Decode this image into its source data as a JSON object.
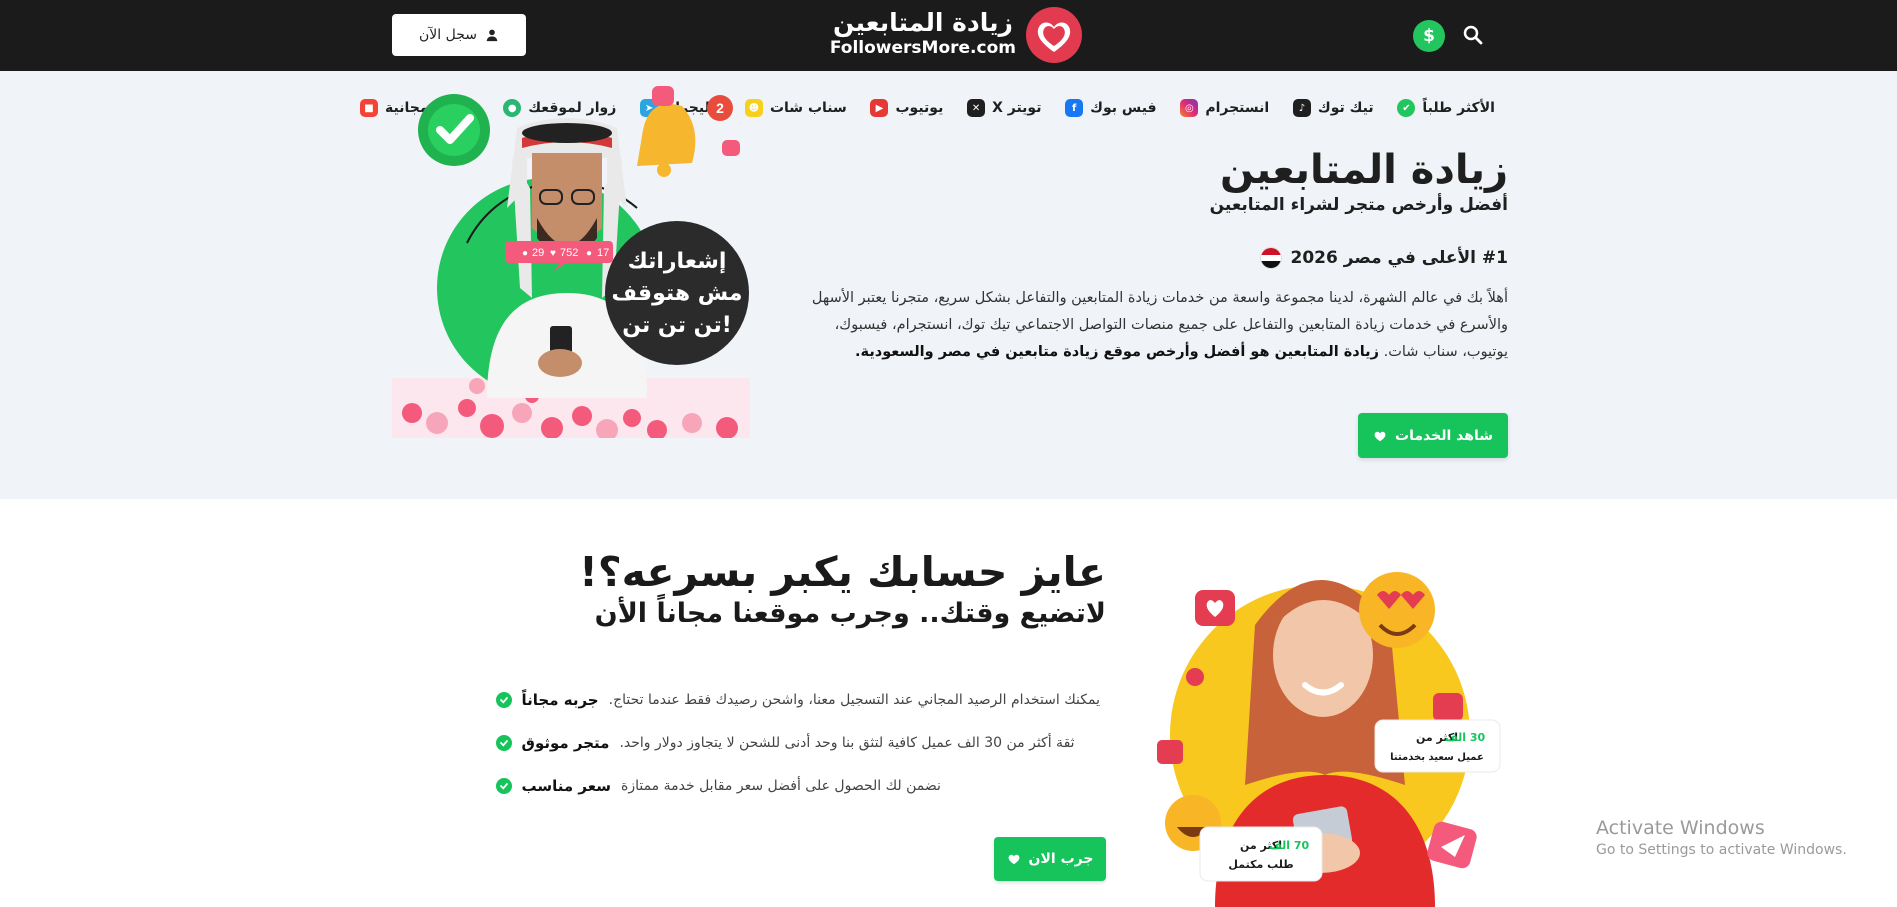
{
  "header": {
    "register_label": "سجل الآن",
    "logo_ar": "زيادة المتابعين",
    "logo_en": "FollowersMore.com",
    "dollar_symbol": "$",
    "icons": [
      "user-icon",
      "heart-logo-icon",
      "dollar-icon",
      "search-icon"
    ]
  },
  "nav": {
    "items": [
      {
        "label": "الأكثر طلباً",
        "icon": "check-badge-icon",
        "color": "#22c55e"
      },
      {
        "label": "تيك توك",
        "icon": "tiktok-icon",
        "color": "#1f1f1f"
      },
      {
        "label": "انستجرام",
        "icon": "instagram-icon",
        "color": "#d62976"
      },
      {
        "label": "فيس بوك",
        "icon": "facebook-icon",
        "color": "#1877f2"
      },
      {
        "label": "تويتر X",
        "icon": "x-icon",
        "color": "#1f1f1f"
      },
      {
        "label": "يوتيوب",
        "icon": "youtube-icon",
        "color": "#e53935"
      },
      {
        "label": "سناب شات",
        "icon": "snapchat-icon",
        "color": "#f7d01c"
      },
      {
        "label": "تيليجرام",
        "icon": "telegram-icon",
        "color": "#2aa5e0"
      },
      {
        "label": "زوار لموقعك",
        "icon": "globe-icon",
        "color": "#2bb673"
      },
      {
        "label": "خدمات مجانية",
        "icon": "gift-icon",
        "color": "#f44336"
      }
    ]
  },
  "hero": {
    "title": "زيادة المتابعين",
    "subtitle": "أفضل وأرخص متجر لشراء المتابعين",
    "rank": "#1 الأعلى في مصر 2026",
    "desc_1": "أهلاً بك في عالم الشهرة، لدينا مجموعة واسعة من خدمات زيادة المتابعين والتفاعل بشكل سريع، متجرنا يعتبر الأسهل والأسرع في خدمات زيادة المتابعين والتفاعل على جميع منصات التواصل الاجتماعي تيك توك، انستجرام، فيسبوك، يوتيوب، سناب شات.",
    "desc_bold": "زيادة المتابعين هو أفضل وأرخص موقع زيادة متابعين في مصر والسعودية.",
    "cta": "شاهد الخدمات",
    "image": {
      "bubble_line1": "إشعاراتك",
      "bubble_line2": "مش هتوقف",
      "bubble_line3": "تن تن تن!",
      "stat_followers": "17",
      "stat_likes": "752",
      "stat_comments": "29",
      "badge_count": "2"
    }
  },
  "section2": {
    "title": "عايز حسابك يكبر بسرعه؟!",
    "subtitle": "لاتضيع وقتك.. وجرب موقعنا مجاناً الأن",
    "features": [
      {
        "title": "جربه مجاناً",
        "text": "يمكنك استخدام الرصيد المجاني عند التسجيل معنا، واشحن رصيدك فقط عندما تحتاج."
      },
      {
        "title": "متجر موثوق",
        "text": "ثقة أكثر من 30 الف عميل كافية لتثق بنا وحد أدنى للشحن لا يتجاوز دولار واحد."
      },
      {
        "title": "سعر مناسب",
        "text": "نضمن لك الحصول على أفضل سعر مقابل خدمة ممتازة"
      }
    ],
    "cta": "جرب الان",
    "image": {
      "card1_pre": "اكثر من",
      "card1_num": "30 الف",
      "card1_post": "عميل سعيد بخدمتنا",
      "card2_pre": "اكثر من",
      "card2_num": "70 الف",
      "card2_post": "طلب مكتمل"
    }
  },
  "watermark": {
    "title": "Activate Windows",
    "subtitle": "Go to Settings to activate Windows."
  },
  "colors": {
    "header_bg": "#1b1b1b",
    "hero_bg": "#f0f4f8",
    "accent_green": "#16c45b",
    "dollar_green": "#22c55e"
  }
}
